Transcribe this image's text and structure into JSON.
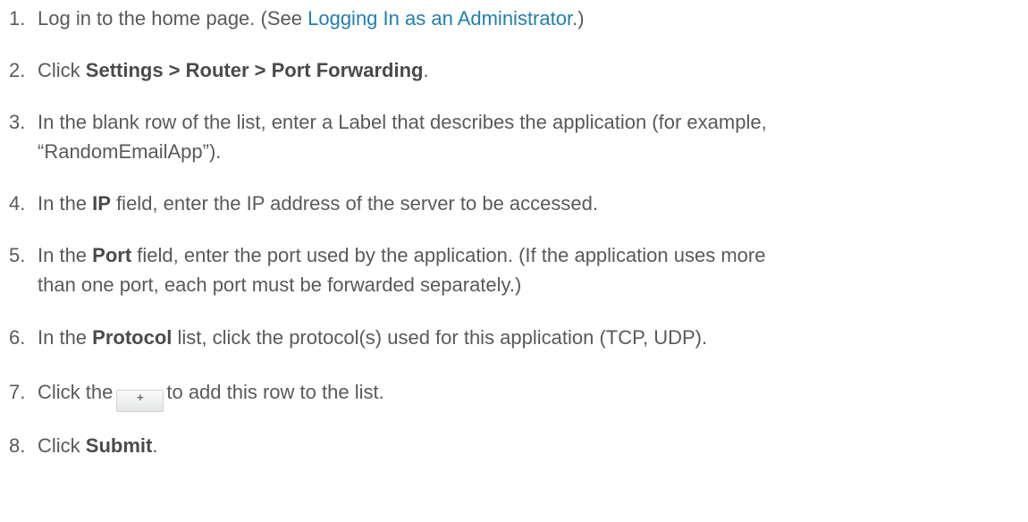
{
  "steps": [
    {
      "num": "1.",
      "pre": "Log in to the home page. (See ",
      "link": "Logging In as an Administrator",
      "post": ".)"
    },
    {
      "num": "2.",
      "pre": "Click ",
      "bold": "Settings > Router > Port Forwarding",
      "post": "."
    },
    {
      "num": "3.",
      "line1": "In the blank row of the list, enter a Label that describes the application (for example,",
      "line2": "“RandomEmailApp”)."
    },
    {
      "num": "4.",
      "pre": "In the ",
      "bold": "IP",
      "post": " field, enter the IP address of the server to be accessed."
    },
    {
      "num": "5.",
      "pre": "In the ",
      "bold": "Port",
      "post": " field, enter the port used by the application. (If the application uses more",
      "line2": "than one port, each port must be forwarded separately.)"
    },
    {
      "num": "6.",
      "pre": "In the ",
      "bold": "Protocol",
      "post": " list, click the protocol(s) used for this application (TCP, UDP)."
    },
    {
      "num": "7.",
      "pre": "Click the",
      "button": "+",
      "post": "to add this row to the list."
    },
    {
      "num": "8.",
      "pre": "Click ",
      "bold": "Submit",
      "post": "."
    }
  ]
}
